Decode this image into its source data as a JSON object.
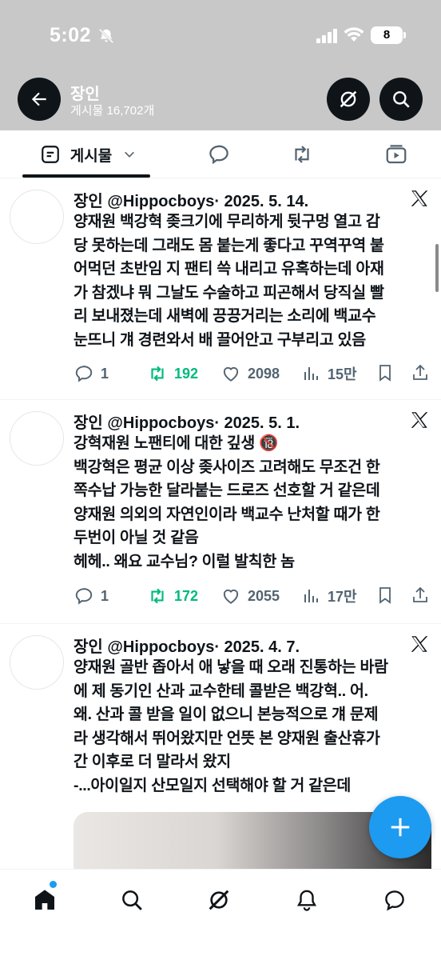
{
  "status_bar": {
    "time": "5:02",
    "battery": "8"
  },
  "header": {
    "title": "장인",
    "subtitle": "게시물 16,702개"
  },
  "tabs": {
    "posts_label": "게시물"
  },
  "tweets": [
    {
      "name": "장인",
      "handle": "@Hippocboys",
      "date": "· 2025. 5. 14.",
      "text": "양재원 백강혁 좆크기에 무리하게 뒷구멍 열고 감\n당 못하는데 그래도 몸 붙는게 좋다고 꾸역꾸역 붙\n어먹던 초반임 지 팬티 쓱 내리고 유혹하는데 아재\n가 참겠냐 뭐 그날도 수술하고 피곤해서 당직실 빨\n리 보내졌는데 새벽에 끙끙거리는 소리에 백교수\n눈뜨니 걔 경련와서 배 끌어안고 구부리고 있음",
      "replies": "1",
      "reposts": "192",
      "likes": "2098",
      "views": "15만"
    },
    {
      "name": "장인",
      "handle": "@Hippocboys",
      "date": "· 2025. 5. 1.",
      "text": "강혁재원 노팬티에 대한 깊생 🔞\n백강혁은 평균 이상 좆사이즈 고려해도 무조건 한\n쪽수납 가능한 달라붙는 드로즈 선호할 거 같은데\n양재원 의외의 자연인이라 백교수 난처할 때가 한\n두번이 아닐 것 같음\n헤헤.. 왜요 교수님? 이럴 발칙한 놈",
      "replies": "1",
      "reposts": "172",
      "likes": "2055",
      "views": "17만"
    },
    {
      "name": "장인",
      "handle": "@Hippocboys",
      "date": "· 2025. 4. 7.",
      "text": "양재원 골반 좁아서 애 낳을 때 오래 진통하는 바람\n에 제 동기인 산과 교수한테 콜받은 백강혁.. 어.\n왜. 산과 콜 받을 일이 없으니 본능적으로 걔 문제\n라 생각해서 뛰어왔지만 언뜻 본 양재원 출산휴가\n간 이후로 더 말라서 왔지\n-...아이일지 산모일지 선택해야 할 거 같은데"
    }
  ],
  "colors": {
    "accent": "#1d9bf0",
    "repost": "#00ba7c",
    "muted": "#536471",
    "header_bg": "#c8c8c8"
  }
}
